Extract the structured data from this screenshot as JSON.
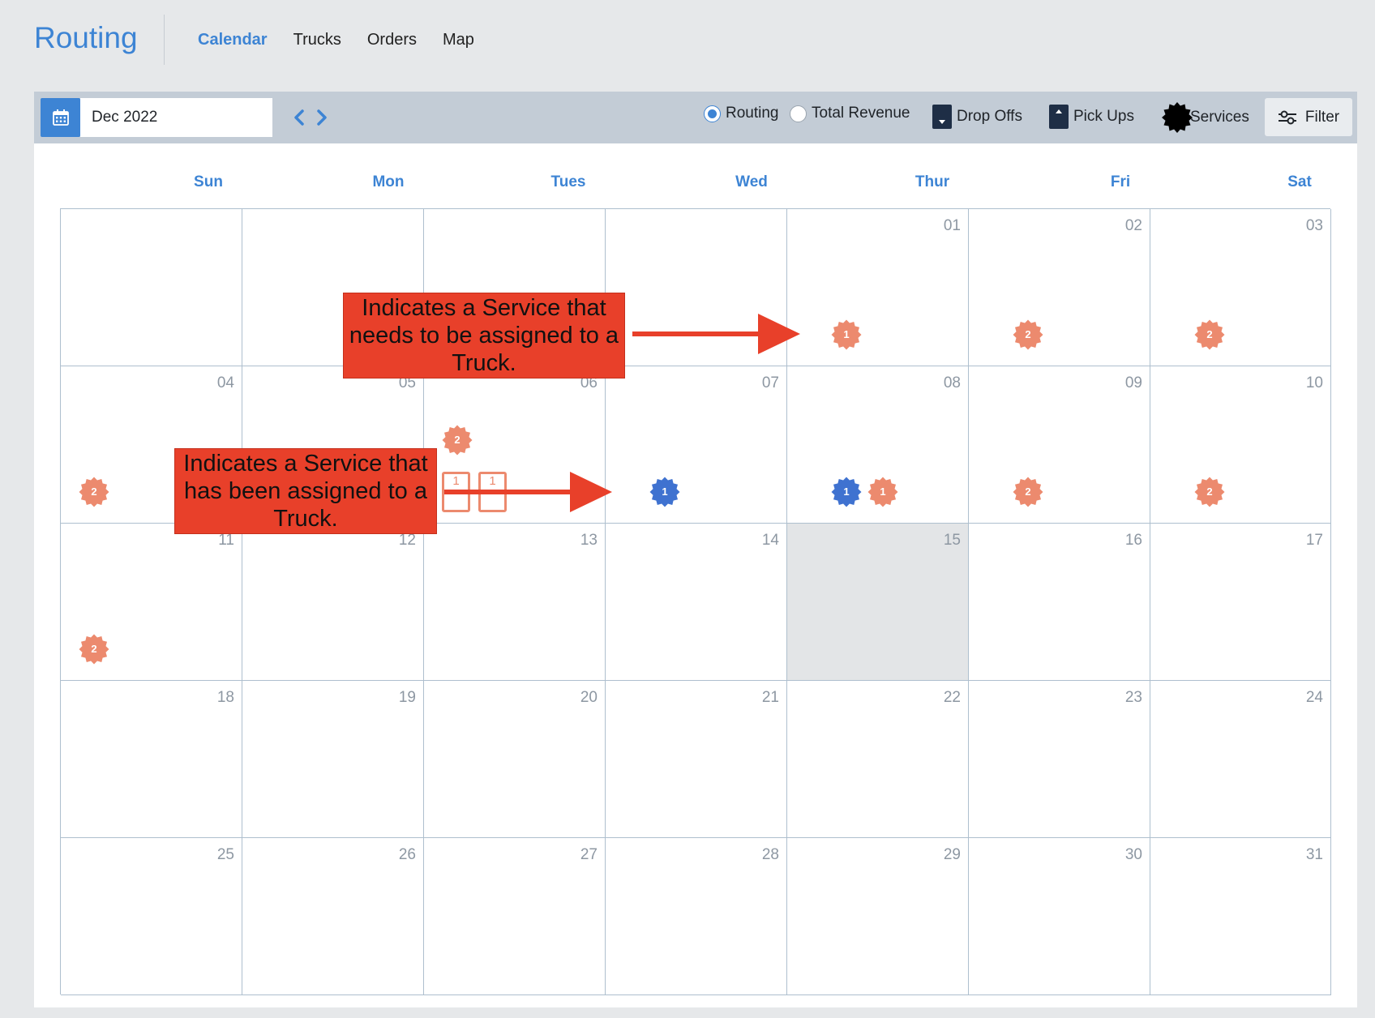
{
  "app": {
    "title": "Routing"
  },
  "nav": {
    "items": [
      "Calendar",
      "Trucks",
      "Orders",
      "Map"
    ],
    "active": "Calendar"
  },
  "toolbar": {
    "date_value": "Dec 2022",
    "options": {
      "routing": "Routing",
      "total_revenue": "Total Revenue",
      "drop_offs": "Drop Offs",
      "pick_ups": "Pick Ups",
      "services": "Services"
    },
    "selected_view": "Routing",
    "filter_label": "Filter"
  },
  "calendar": {
    "weekdays": [
      "Sun",
      "Mon",
      "Tues",
      "Wed",
      "Thur",
      "Fri",
      "Sat"
    ],
    "weeks": [
      [
        "",
        "",
        "",
        "",
        "01",
        "02",
        "03"
      ],
      [
        "04",
        "05",
        "06",
        "07",
        "08",
        "09",
        "10"
      ],
      [
        "11",
        "12",
        "13",
        "14",
        "15",
        "16",
        "17"
      ],
      [
        "18",
        "19",
        "20",
        "21",
        "22",
        "23",
        "24"
      ],
      [
        "25",
        "26",
        "27",
        "28",
        "29",
        "30",
        "31"
      ]
    ],
    "today": "15",
    "badges": {
      "d01_unassigned": "1",
      "d02_unassigned": "2",
      "d03_unassigned": "2",
      "d04_unassigned": "2",
      "d06_unassigned": "2",
      "d07_assigned": "1",
      "d08_assigned": "1",
      "d08_unassigned": "1",
      "d09_unassigned": "2",
      "d10_unassigned": "2",
      "d11_unassigned": "2"
    },
    "d06_dropoff_count": "1",
    "d06_pickup_count": "1"
  },
  "colors": {
    "accent": "#3d84d4",
    "unassigned": "#ec8a6e",
    "assigned": "#3f72d0",
    "annotation": "#e8402a"
  },
  "annotations": {
    "unassigned_note": "Indicates a Service that needs to be assigned to a Truck.",
    "assigned_note": "Indicates a Service that has been assigned to a Truck."
  }
}
